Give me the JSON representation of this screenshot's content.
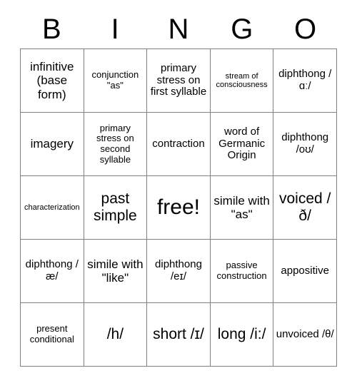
{
  "card": {
    "title_letters": [
      "B",
      "I",
      "N",
      "G",
      "O"
    ],
    "free_space_label": "free!",
    "rows": [
      [
        {
          "text": "infinitive (base form)",
          "size": "l"
        },
        {
          "text": "conjunction \"as\"",
          "size": "s"
        },
        {
          "text": "primary stress on first syllable",
          "size": "m"
        },
        {
          "text": "stream of consciousness",
          "size": "xs"
        },
        {
          "text": "diphthong /ɑː/",
          "size": "m"
        }
      ],
      [
        {
          "text": "imagery",
          "size": "l"
        },
        {
          "text": "primary stress on second syllable",
          "size": "s"
        },
        {
          "text": "contraction",
          "size": "m"
        },
        {
          "text": "word of Germanic Origin",
          "size": "m"
        },
        {
          "text": "diphthong /oʊ/",
          "size": "m"
        }
      ],
      [
        {
          "text": "characterization",
          "size": "xs"
        },
        {
          "text": "past simple",
          "size": "xl"
        },
        {
          "text": "free!",
          "size": "free"
        },
        {
          "text": "simile with \"as\"",
          "size": "l"
        },
        {
          "text": "voiced /ð/",
          "size": "xl"
        }
      ],
      [
        {
          "text": "diphthong /æ/",
          "size": "m"
        },
        {
          "text": "simile with \"like\"",
          "size": "l"
        },
        {
          "text": "diphthong /eɪ/",
          "size": "m"
        },
        {
          "text": "passive construction",
          "size": "s"
        },
        {
          "text": "appositive",
          "size": "m"
        }
      ],
      [
        {
          "text": "present conditional",
          "size": "s"
        },
        {
          "text": "/h/",
          "size": "xl"
        },
        {
          "text": "short /ɪ/",
          "size": "xl"
        },
        {
          "text": "long /i:/",
          "size": "xl"
        },
        {
          "text": "unvoiced /θ/",
          "size": "m"
        }
      ]
    ]
  }
}
